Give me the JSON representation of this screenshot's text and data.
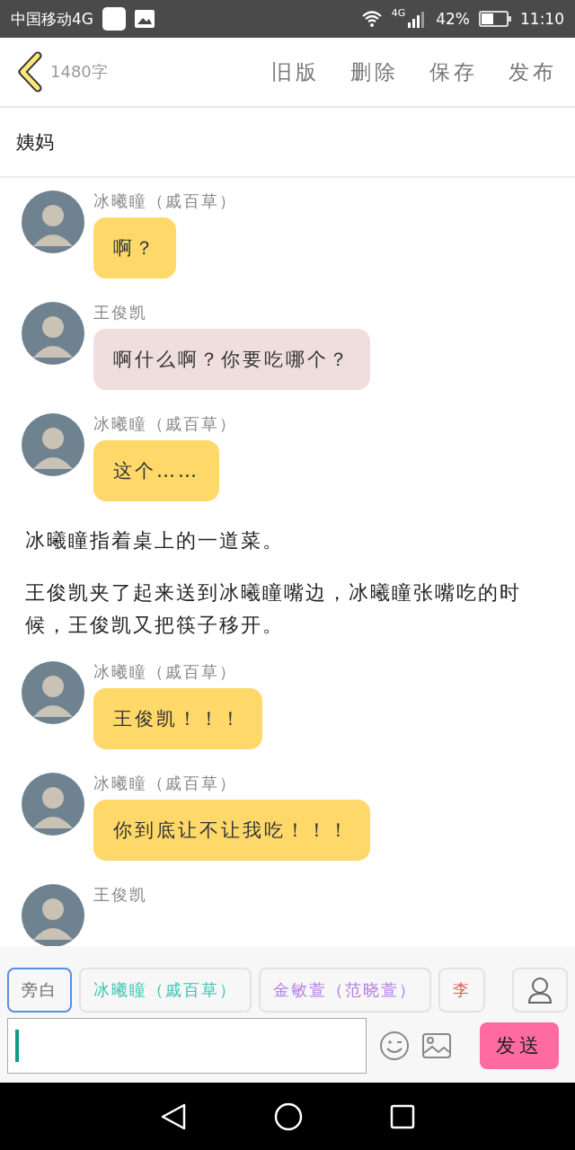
{
  "status_bar": {
    "carrier": "中国移动4G",
    "network": "4G",
    "battery": "42%",
    "time": "11:10"
  },
  "top_bar": {
    "word_count": "1480字",
    "actions": [
      "旧版",
      "删除",
      "保存",
      "发布"
    ]
  },
  "title": "姨妈",
  "messages": [
    {
      "kind": "message",
      "name": "冰曦瞳（戚百草）",
      "text": "啊？",
      "color": "#fed96a"
    },
    {
      "kind": "message",
      "name": "王俊凯",
      "text": "啊什么啊？你要吃哪个？",
      "color": "#f0dede"
    },
    {
      "kind": "message",
      "name": "冰曦瞳（戚百草）",
      "text": "这个……",
      "color": "#fed96a"
    },
    {
      "kind": "narration",
      "text": "冰曦瞳指着桌上的一道菜。"
    },
    {
      "kind": "narration",
      "text": "王俊凯夹了起来送到冰曦瞳嘴边，冰曦瞳张嘴吃的时候，王俊凯又把筷子移开。"
    },
    {
      "kind": "message",
      "name": "冰曦瞳（戚百草）",
      "text": "王俊凯！！！",
      "color": "#fed96a"
    },
    {
      "kind": "message",
      "name": "冰曦瞳（戚百草）",
      "text": "你到底让不让我吃！！！",
      "color": "#fed96a"
    },
    {
      "kind": "message",
      "name": "王俊凯"
    }
  ],
  "characters": [
    {
      "label": "旁白",
      "selected": true,
      "color": "#666666"
    },
    {
      "label": "冰曦瞳（戚百草）",
      "selected": false,
      "color": "#3cc3b4"
    },
    {
      "label": "金敏萱（范晓萱）",
      "selected": false,
      "color": "#b57be0"
    },
    {
      "label": "李",
      "selected": false,
      "color": "#e05a50"
    }
  ],
  "composer": {
    "send": "发送"
  }
}
